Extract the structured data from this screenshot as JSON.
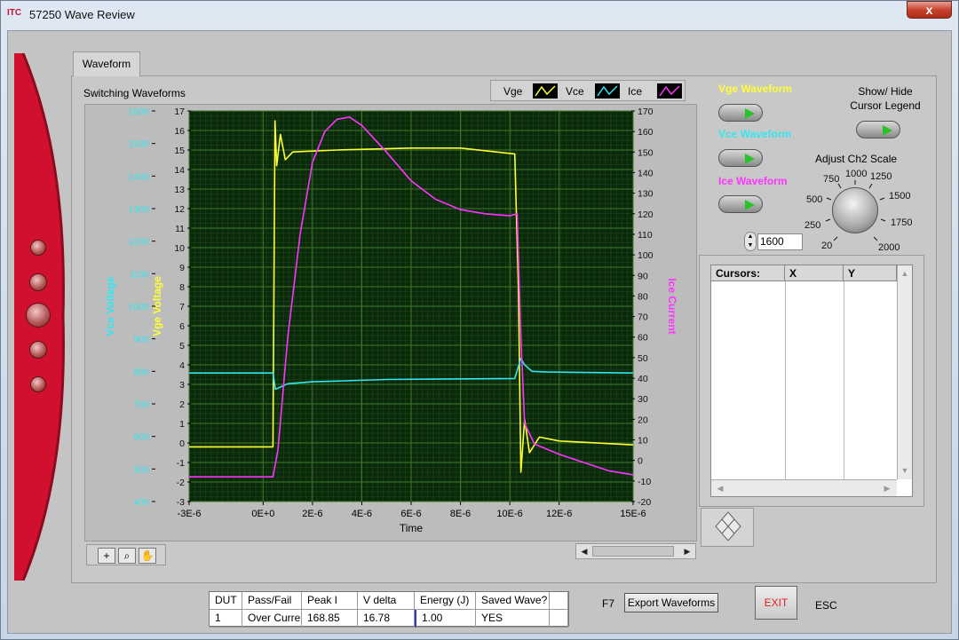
{
  "window": {
    "title": "57250 Wave Review",
    "app_icon_label": "ITC",
    "close_label": "x"
  },
  "tabs": [
    {
      "label": "Waveform",
      "selected": true
    }
  ],
  "graph": {
    "title": "Switching Waveforms",
    "legend": [
      {
        "name": "Vge",
        "color": "#ffff33"
      },
      {
        "name": "Vce",
        "color": "#33e6f0"
      },
      {
        "name": "Ice",
        "color": "#ff33ff"
      }
    ],
    "plot_background": "#0b2a0b",
    "grid_color": "#3d7a2a"
  },
  "chart_data": {
    "type": "line",
    "xlabel": "Time",
    "x_ticks": [
      "-3E-6",
      "0E+0",
      "2E-6",
      "4E-6",
      "6E-6",
      "8E-6",
      "10E-6",
      "12E-6",
      "15E-6"
    ],
    "xlim": [
      -3e-06,
      1.5e-05
    ],
    "axes": {
      "vce": {
        "label": "Vce Voltage",
        "color": "#33e6f0",
        "ylim": [
          400,
          1600
        ],
        "ticks": [
          "400",
          "500",
          "600",
          "700",
          "800",
          "900",
          "1000",
          "1100",
          "1200",
          "1300",
          "1400",
          "1500",
          "1600"
        ]
      },
      "vge": {
        "label": "Vge Voltage",
        "color": "#ffff33",
        "ylim": [
          -3,
          17
        ],
        "ticks": [
          "-3",
          "-2",
          "-1",
          "0",
          "1",
          "2",
          "3",
          "4",
          "5",
          "6",
          "7",
          "8",
          "9",
          "10",
          "11",
          "12",
          "13",
          "14",
          "15",
          "16",
          "17"
        ]
      },
      "ice": {
        "label": "Ice Current",
        "color": "#ff33ff",
        "ylim": [
          -20,
          170
        ],
        "ticks": [
          "-20",
          "-10",
          "0",
          "10",
          "20",
          "30",
          "40",
          "50",
          "60",
          "70",
          "80",
          "90",
          "100",
          "110",
          "120",
          "130",
          "140",
          "150",
          "160",
          "170"
        ]
      }
    },
    "series": [
      {
        "name": "Vge",
        "axis": "vge",
        "color": "#ffff33",
        "x": [
          -3e-06,
          4e-07,
          4.8e-07,
          5.5e-07,
          7e-07,
          9e-07,
          1.2e-06,
          3e-06,
          6e-06,
          8e-06,
          1.02e-05,
          1.035e-05,
          1.045e-05,
          1.06e-05,
          1.08e-05,
          1.12e-05,
          1.2e-05,
          1.5e-05
        ],
        "y": [
          -0.2,
          -0.2,
          16.5,
          14.2,
          15.8,
          14.5,
          14.9,
          15.0,
          15.1,
          15.1,
          14.8,
          8,
          -1.5,
          1.2,
          -0.5,
          0.3,
          0.1,
          -0.1
        ]
      },
      {
        "name": "Vce",
        "axis": "vce",
        "color": "#33e6f0",
        "x": [
          -3e-06,
          4e-07,
          5e-07,
          1e-06,
          2e-06,
          3e-06,
          5e-06,
          7e-06,
          1.02e-05,
          1.045e-05,
          1.06e-05,
          1.09e-05,
          1.15e-05,
          1.5e-05
        ],
        "y": [
          795,
          795,
          745,
          762,
          768,
          770,
          775,
          776,
          778,
          840,
          820,
          800,
          798,
          795
        ]
      },
      {
        "name": "Ice",
        "axis": "ice",
        "color": "#ff33ff",
        "x": [
          -3e-06,
          4e-07,
          6e-07,
          1e-06,
          1.5e-06,
          2e-06,
          2.5e-06,
          3e-06,
          3.5e-06,
          4e-06,
          5e-06,
          6e-06,
          7e-06,
          8e-06,
          9e-06,
          1e-05,
          1.03e-05,
          1.045e-05,
          1.06e-05,
          1.1e-05,
          1.2e-05,
          1.3e-05,
          1.4e-05,
          1.5e-05
        ],
        "y": [
          -8,
          -8,
          5,
          60,
          110,
          145,
          160,
          166,
          167,
          163,
          150,
          136,
          127,
          122,
          120,
          119,
          120,
          60,
          18,
          8,
          3,
          -1,
          -5,
          -7
        ]
      }
    ]
  },
  "palette": {
    "buttons": [
      "crosshair-tool",
      "zoom-tool",
      "pan-tool"
    ]
  },
  "controls": {
    "vge_label": "Vge Waveform",
    "vge_color": "#ffff33",
    "vce_label": "Vce Waveform",
    "vce_color": "#33e6f0",
    "ice_label": "Ice Waveform",
    "ice_color": "#ff33ff",
    "show_hide_label": "Show/ Hide Cursor Legend",
    "adjust_label": "Adjust Ch2 Scale",
    "knob_ticks": [
      "20",
      "250",
      "500",
      "750",
      "1000",
      "1250",
      "1500",
      "1750",
      "2000"
    ],
    "scale_value": "1600"
  },
  "cursor_table": {
    "headers": [
      "Cursors:",
      "X",
      "Y"
    ]
  },
  "results": {
    "headers": [
      "DUT",
      "Pass/Fail",
      "Peak I",
      "V delta",
      "Energy (J)",
      "Saved Wave?",
      ""
    ],
    "row": [
      "1",
      "Over Curre",
      "168.85",
      "16.78",
      "1.00",
      "YES",
      ""
    ]
  },
  "buttons": {
    "f7_label": "F7",
    "export_label": "Export Waveforms",
    "exit_label": "EXIT",
    "esc_label": "ESC"
  }
}
